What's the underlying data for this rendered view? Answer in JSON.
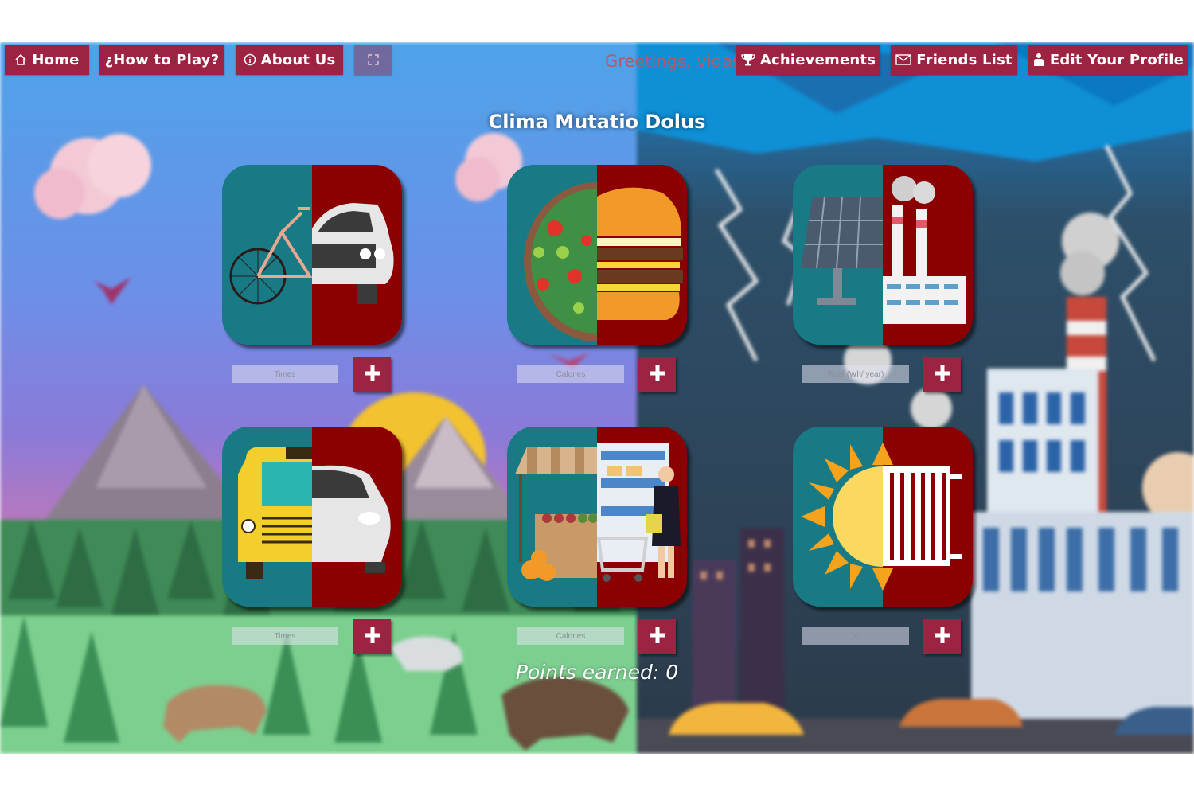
{
  "nav": {
    "home_label": "Home",
    "how_to_play_label": "¿How to Play?",
    "about_label": "About Us",
    "greeting": "Greetings, vidas",
    "achievements_label": "Achievements",
    "friends_label": "Friends List",
    "profile_label": "Edit Your Profile"
  },
  "title": "Clima Mutatio Dolus",
  "cards": [
    {
      "name": "transport",
      "placeholder": "Times"
    },
    {
      "name": "food",
      "placeholder": "Calories"
    },
    {
      "name": "energy",
      "placeholder": "Total (Wh/ year)"
    },
    {
      "name": "commute",
      "placeholder": "Times"
    },
    {
      "name": "shopping",
      "placeholder": "Calories"
    },
    {
      "name": "heating",
      "placeholder": "°C"
    }
  ],
  "add_button_symbol": "+",
  "points_text": "Points earned: 0",
  "colors": {
    "accent": "#9c2342",
    "card_green": "#177a85",
    "card_red": "#8b0000"
  }
}
